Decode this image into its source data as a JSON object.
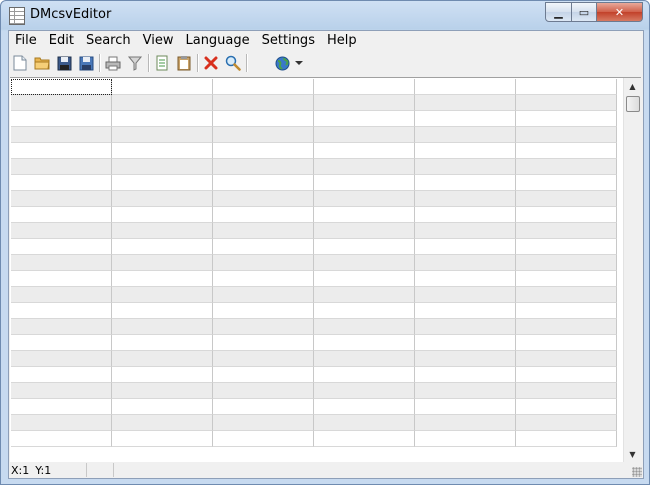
{
  "window": {
    "title": "DMcsvEditor"
  },
  "menu": [
    "File",
    "Edit",
    "Search",
    "View",
    "Language",
    "Settings",
    "Help"
  ],
  "toolbar": {
    "buttons": [
      "new-file-icon",
      "open-folder-icon",
      "save-icon",
      "save-as-icon",
      "print-icon",
      "filter-icon",
      "copy-icon",
      "paste-icon",
      "delete-icon",
      "find-icon",
      "globe-icon",
      "dropdown-arrow-icon"
    ]
  },
  "grid": {
    "columns": 6,
    "rows": 23,
    "active_cell": [
      0,
      0
    ]
  },
  "status": {
    "x": "X:1",
    "y": "Y:1"
  }
}
